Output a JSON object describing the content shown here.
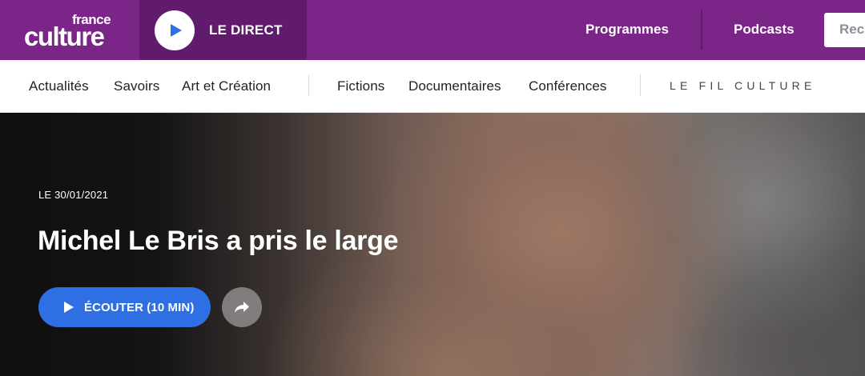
{
  "brand": {
    "logo_small": "france",
    "logo_big": "culture",
    "colors": {
      "topbar": "#7b2588",
      "direct_bg": "#611b6c",
      "accent_blue": "#2f6fe4"
    }
  },
  "header": {
    "direct_label": "LE DIRECT",
    "direct_icon": "play-icon",
    "links": [
      "Programmes",
      "Podcasts"
    ],
    "search_text": "Rech"
  },
  "subnav": {
    "group1": [
      "Actualités",
      "Savoirs",
      "Art et Création"
    ],
    "group2": [
      "Fictions",
      "Documentaires",
      "Conférences"
    ],
    "fil_culture": "LE FIL CULTURE"
  },
  "hero": {
    "date": "LE 30/01/2021",
    "title": "Michel Le Bris a pris le large",
    "listen_label": "ÉCOUTER (10 MIN)",
    "listen_icon": "play-icon",
    "share_icon": "share-icon"
  }
}
